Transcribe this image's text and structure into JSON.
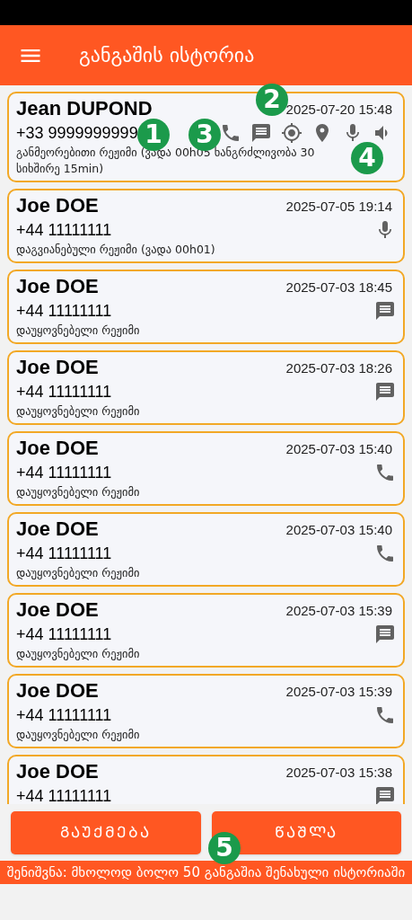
{
  "header": {
    "title": "განგაშის ისტორია"
  },
  "alerts": [
    {
      "name": "Jean DUPOND",
      "phone": "+33 9999999999",
      "time": "2025-07-20 15:48",
      "mode": "განმეორებითი რეჟიმი (ვადა 00h05 ხანგრძლივობა 30 სიხშირე 15min)",
      "icons": [
        {
          "kind": "phone"
        },
        {
          "kind": "message"
        },
        {
          "kind": "gps"
        },
        {
          "kind": "pin"
        },
        {
          "kind": "mic"
        },
        {
          "kind": "speaker"
        }
      ]
    },
    {
      "name": "Joe DOE",
      "phone": "+44 11111111",
      "time": "2025-07-05 19:14",
      "mode": "დაგვიანებული რეჟიმი (ვადა 00h01)",
      "icons": [
        {
          "kind": "mic"
        }
      ]
    },
    {
      "name": "Joe DOE",
      "phone": "+44 11111111",
      "time": "2025-07-03 18:45",
      "mode": "დაუყოვნებელი რეჟიმი",
      "icons": [
        {
          "kind": "message"
        }
      ]
    },
    {
      "name": "Joe DOE",
      "phone": "+44 11111111",
      "time": "2025-07-03 18:26",
      "mode": "დაუყოვნებელი რეჟიმი",
      "icons": [
        {
          "kind": "message"
        }
      ]
    },
    {
      "name": "Joe DOE",
      "phone": "+44 11111111",
      "time": "2025-07-03 15:40",
      "mode": "დაუყოვნებელი რეჟიმი",
      "icons": [
        {
          "kind": "phone"
        }
      ]
    },
    {
      "name": "Joe DOE",
      "phone": "+44 11111111",
      "time": "2025-07-03 15:40",
      "mode": "დაუყოვნებელი რეჟიმი",
      "icons": [
        {
          "kind": "phone"
        }
      ]
    },
    {
      "name": "Joe DOE",
      "phone": "+44 11111111",
      "time": "2025-07-03 15:39",
      "mode": "დაუყოვნებელი რეჟიმი",
      "icons": [
        {
          "kind": "message"
        }
      ]
    },
    {
      "name": "Joe DOE",
      "phone": "+44 11111111",
      "time": "2025-07-03 15:39",
      "mode": "დაუყოვნებელი რეჟიმი",
      "icons": [
        {
          "kind": "phone"
        }
      ]
    },
    {
      "name": "Joe DOE",
      "phone": "+44 11111111",
      "time": "2025-07-03 15:38",
      "icons": [
        {
          "kind": "message"
        }
      ]
    }
  ],
  "buttons": [
    {
      "label": "ᲒᲐᲣᲥᲛᲔᲑᲐ"
    },
    {
      "label": "ᲬᲐᲨᲚᲐ"
    }
  ],
  "note": "შენიშვნა: მხოლოდ ბოლო 50 განგაშია შენახული ისტორიაში",
  "markers": [
    "1",
    "2",
    "3",
    "4",
    "5"
  ]
}
